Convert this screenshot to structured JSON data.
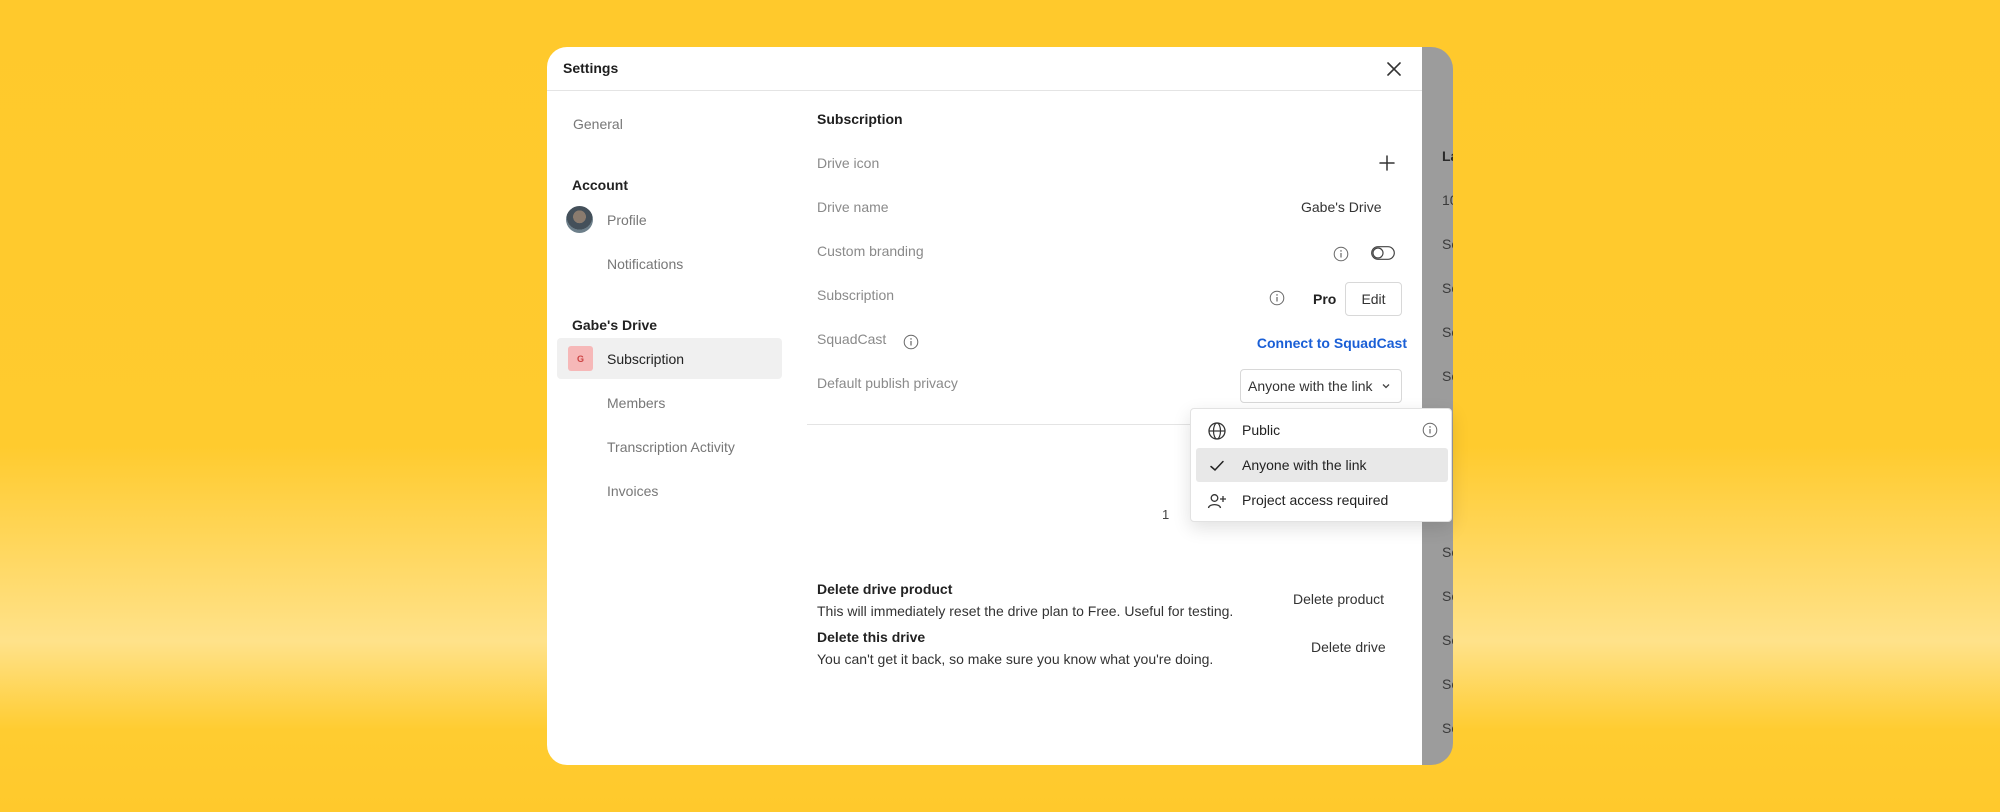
{
  "background_app": {
    "heading": "La",
    "rows": [
      "10",
      "Se",
      "Se",
      "Se",
      "Se",
      "Se",
      "Se",
      "Se",
      "Se",
      "Se",
      "Se"
    ]
  },
  "modal": {
    "title": "Settings",
    "close_icon": "close-icon"
  },
  "sidebar": {
    "general": "General",
    "account_heading": "Account",
    "profile": "Profile",
    "notifications": "Notifications",
    "drive_heading": "Gabe's Drive",
    "drive_badge": "G",
    "subscription": "Subscription",
    "members": "Members",
    "transcription_activity": "Transcription Activity",
    "invoices": "Invoices"
  },
  "content": {
    "section_title": "Subscription",
    "rows": {
      "drive_icon_label": "Drive icon",
      "drive_name_label": "Drive name",
      "drive_name_value": "Gabe's Drive",
      "custom_branding_label": "Custom branding",
      "custom_branding_enabled": false,
      "subscription_label": "Subscription",
      "subscription_plan": "Pro",
      "edit_label": "Edit",
      "squadcast_label": "SquadCast",
      "squadcast_link": "Connect to SquadCast",
      "privacy_label": "Default publish privacy",
      "privacy_value": "Anyone with the link"
    },
    "danger": {
      "delete_product_title": "Delete drive product",
      "delete_product_desc": "This will immediately reset the drive plan to Free. Useful for testing.",
      "delete_product_btn": "Delete product",
      "delete_drive_title": "Delete this drive",
      "delete_drive_desc": "You can't get it back, so make sure you know what you're doing.",
      "delete_drive_btn": "Delete drive"
    },
    "partial_text": "1"
  },
  "privacy_dropdown": {
    "options": [
      {
        "label": "Public",
        "icon": "globe-icon",
        "selected": false
      },
      {
        "label": "Anyone with the link",
        "icon": "check-icon",
        "selected": true
      },
      {
        "label": "Project access required",
        "icon": "user-plus-icon",
        "selected": false
      }
    ]
  },
  "colors": {
    "background": "#ffc92c",
    "link": "#1a5fd6",
    "drive_badge": "#f6b8b8"
  }
}
